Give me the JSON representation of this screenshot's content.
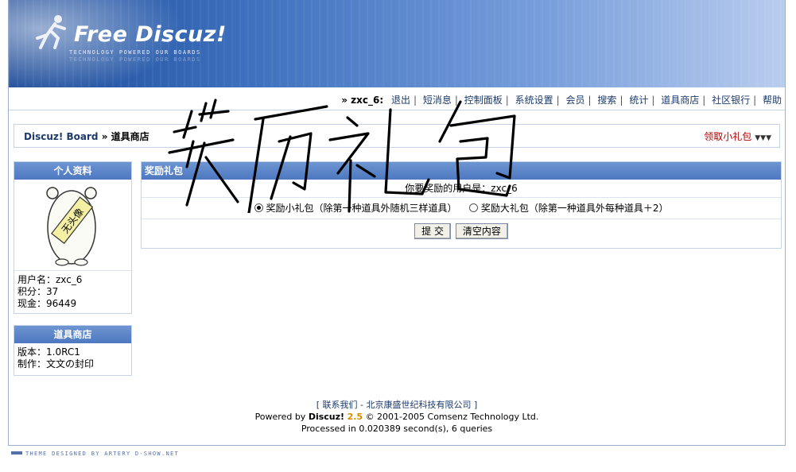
{
  "brand": {
    "title": "Free Discuz!",
    "tagline": "TECHNOLOGY POWERED OUR BOARDS"
  },
  "topnav": {
    "user": "» zxc_6:",
    "links": [
      "退出",
      "短消息",
      "控制面板",
      "系统设置",
      "会员",
      "搜索",
      "统计",
      "道具商店",
      "社区银行",
      "帮助"
    ]
  },
  "breadcrumb": {
    "home": "Discuz! Board",
    "sep": " » ",
    "current": "道具商店",
    "action": "领取小礼包"
  },
  "profile": {
    "title": "个人资料",
    "avatar_text": "无头像",
    "username": "用户名：zxc_6",
    "points": "积分：37",
    "cash": "现金：96449"
  },
  "shop": {
    "title": "道具商店",
    "version": "版本：1.0RC1",
    "author": "制作：文文の封印"
  },
  "main": {
    "title": "奖励礼包",
    "target_label": "你要奖励的用户是：zxc_6",
    "option_small": "奖励小礼包（除第一种道具外随机三样道具）",
    "option_large": "奖励大礼包（除第一种道具外每种道具＋2）",
    "submit": "提 交",
    "reset": "清空内容"
  },
  "handwriting": "奖历礼包",
  "footer": {
    "contact": "联系我们",
    "company": "北京康盛世纪科技有限公司",
    "powered_prefix": "Powered by",
    "brand": "Discuz!",
    "version": "2.5",
    "copyright": "© 2001-2005 Comsenz Technology Ltd.",
    "processed": "Processed in 0.020389 second(s), 6 queries"
  },
  "theme_credit": "THEME DESIGNED BY ARTERY D-SHOW.NET",
  "colors": {
    "header_blue": "#4d78c0",
    "link": "#1c3a6b",
    "action_red": "#b00000",
    "version_gold": "#d98c00"
  }
}
